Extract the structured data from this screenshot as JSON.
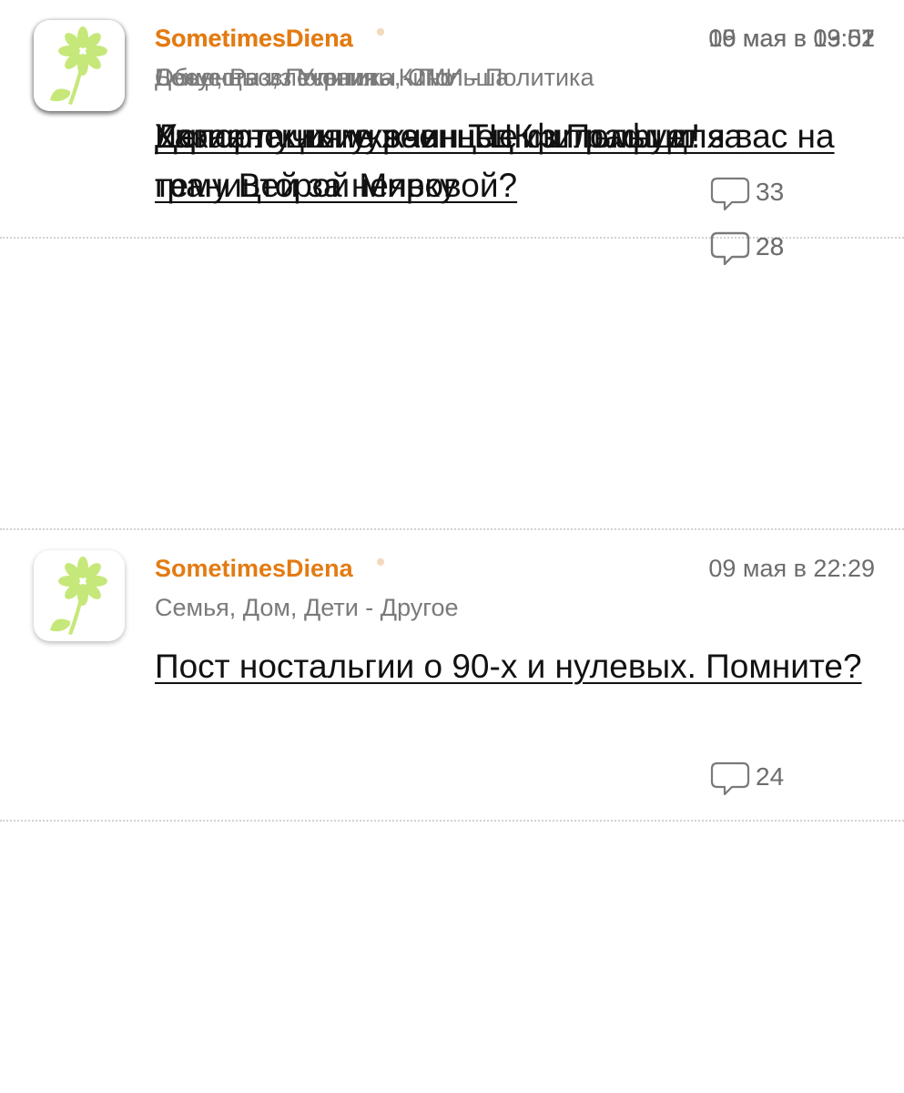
{
  "icons": {
    "avatar": "daisy-flower-icon",
    "comment": "speech-bubble-icon"
  },
  "colors": {
    "author": "#e37b12",
    "meta": "#7a7a7a",
    "flower": "#c6e87a"
  },
  "posts": [
    {
      "author": "SometimesDiena",
      "timestamp": "10 мая в 13:01",
      "category": "Беженцы из Украины - Польша",
      "title": "Депортация украинцев из Польши!",
      "comments": "33"
    },
    {
      "author": "SometimesDiena",
      "timestamp": "09 мая в 22:29",
      "category": "Семья, Дом, Дети - Другое",
      "title": "Пост ностальгии о 90-х и нулевых. Помните?",
      "comments": "24"
    },
    {
      "author": "SometimesDiena",
      "timestamp": "09 мая в 09:57",
      "category": "Досуг, Развлечения - Кино",
      "title": "Какие лучшие военные фильмы для вас на тему Второй Мировой?",
      "comments": "28"
    },
    {
      "author": "SometimesDiena",
      "timestamp": "05 мая в 09:52",
      "category": "Общество, Политика, СМИ - Политика",
      "title": "Украинских мужчин ТЦК штрафует за границей за неявку",
      "comments": "28"
    }
  ]
}
